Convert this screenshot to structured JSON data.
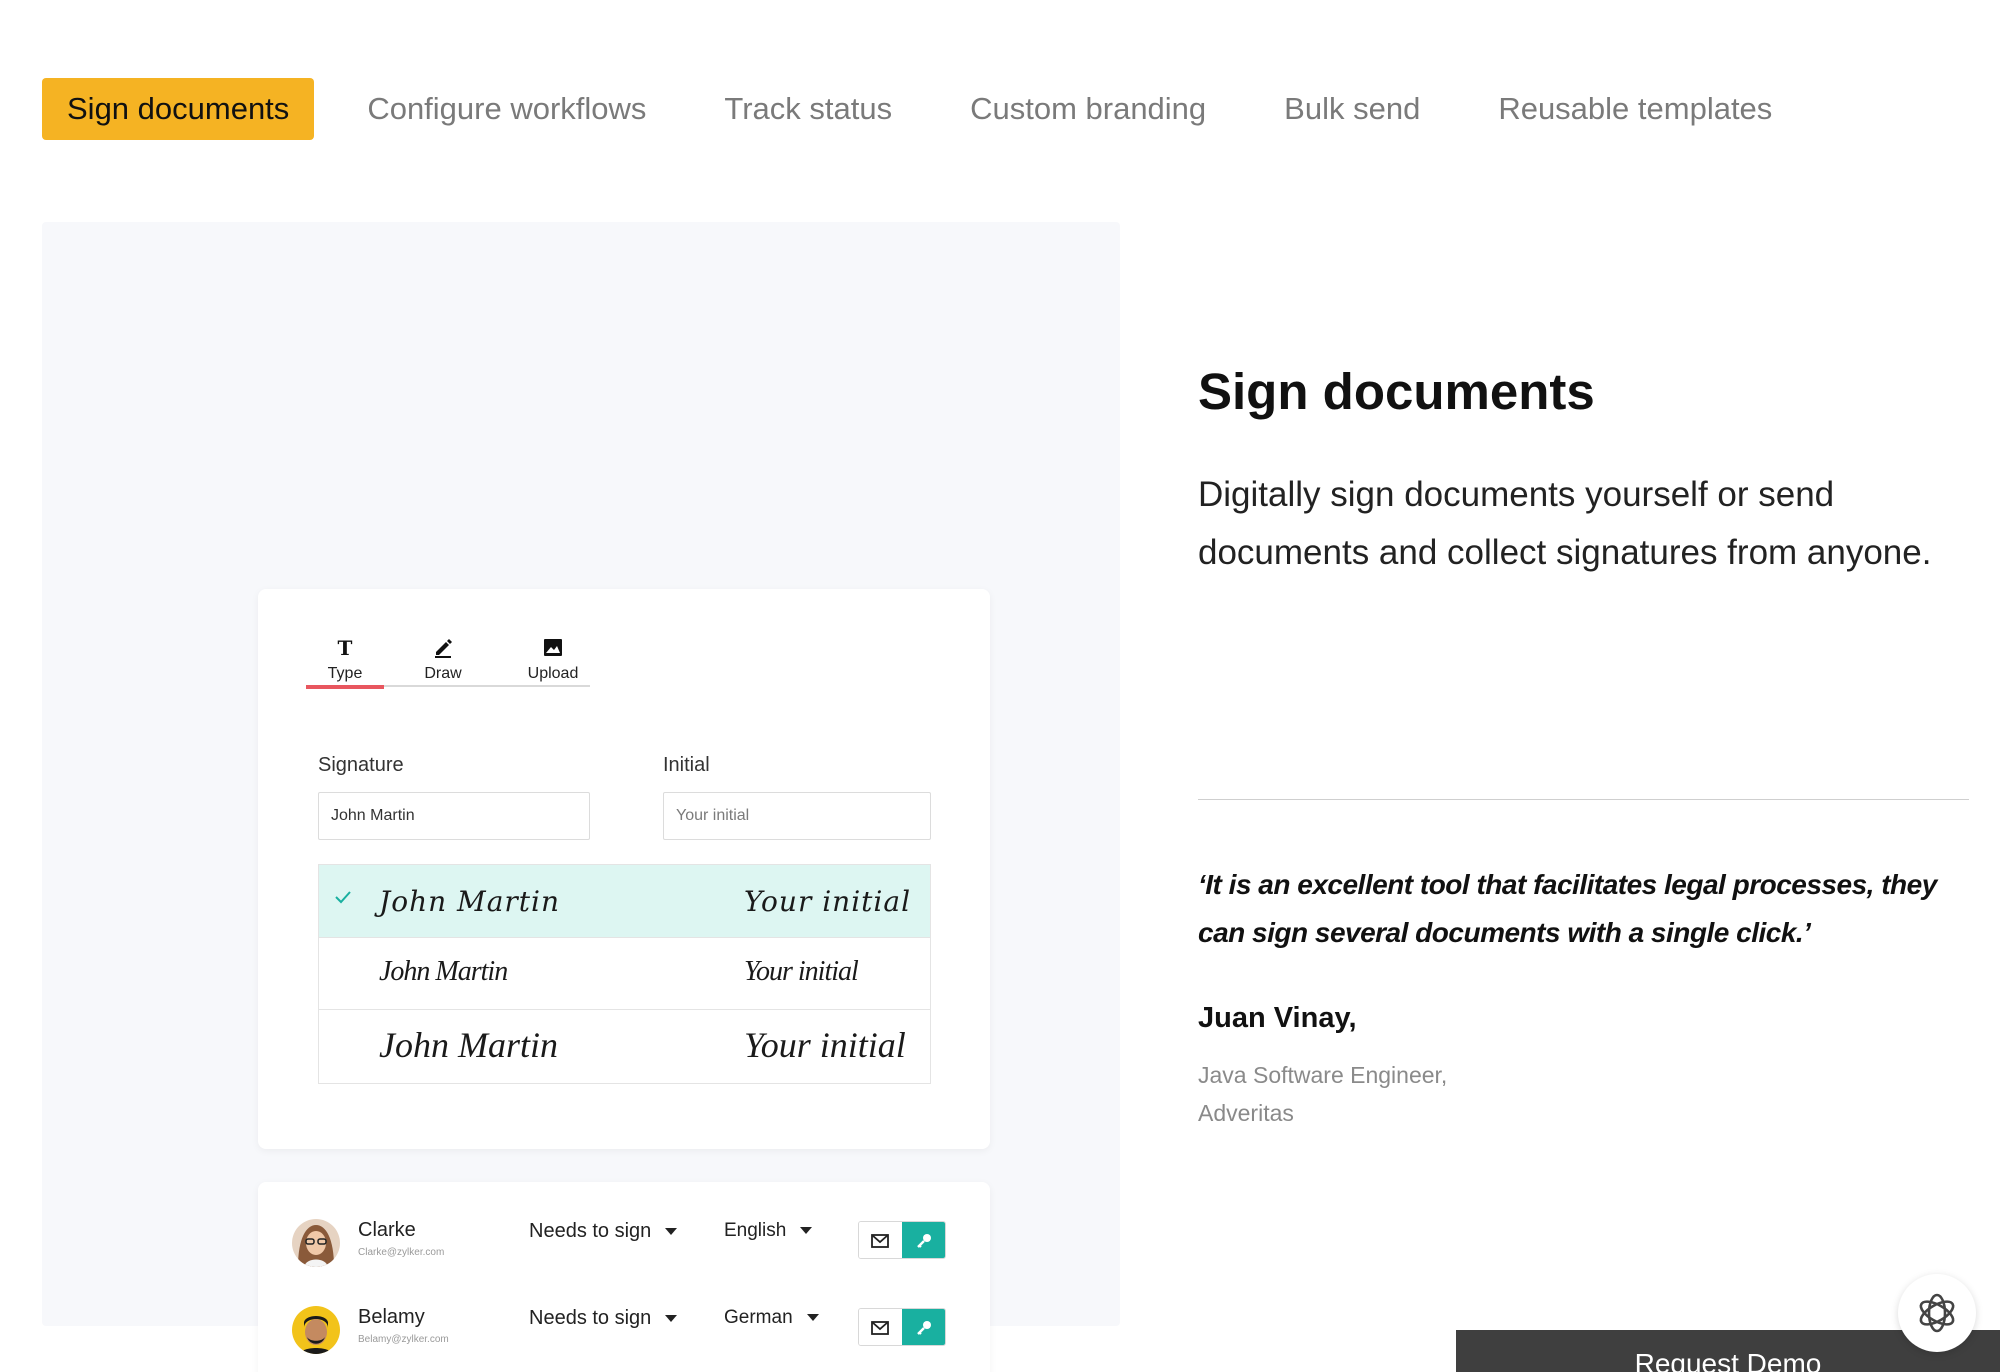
{
  "tabs": [
    {
      "label": "Sign documents",
      "active": true
    },
    {
      "label": "Configure workflows",
      "active": false
    },
    {
      "label": "Track status",
      "active": false
    },
    {
      "label": "Custom branding",
      "active": false
    },
    {
      "label": "Bulk send",
      "active": false
    },
    {
      "label": "Reusable templates",
      "active": false
    }
  ],
  "colors": {
    "accent": "#f5b323",
    "teal": "#19b0a0",
    "selected_row": "#ddf6f2",
    "underline": "#e8565f"
  },
  "signature_card": {
    "modes": [
      {
        "label": "Type",
        "icon": "text-type-icon"
      },
      {
        "label": "Draw",
        "icon": "pencil-icon"
      },
      {
        "label": "Upload",
        "icon": "image-icon"
      }
    ],
    "signature_label": "Signature",
    "signature_value": "John Martin",
    "initial_label": "Initial",
    "initial_placeholder": "Your initial",
    "styles": [
      {
        "signature": "John Martin",
        "initial": "Your initial",
        "selected": true
      },
      {
        "signature": "John Martin",
        "initial": "Your initial",
        "selected": false
      },
      {
        "signature": "John Martin",
        "initial": "Your initial",
        "selected": false
      }
    ]
  },
  "recipients": [
    {
      "name": "Clarke",
      "email": "Clarke@zylker.com",
      "role": "Needs to sign",
      "language": "English"
    },
    {
      "name": "Belamy",
      "email": "Belamy@zylker.com",
      "role": "Needs to sign",
      "language": "German"
    }
  ],
  "content": {
    "heading": "Sign documents",
    "description": "Digitally sign documents yourself or send documents and collect signatures from anyone.",
    "quote": "‘It is an excellent tool that facilitates legal processes, they can sign several documents with a single click.’",
    "author": "Juan Vinay,",
    "author_title": "Java Software Engineer,",
    "author_company": "Adveritas"
  },
  "request_demo_label": "Request Demo"
}
